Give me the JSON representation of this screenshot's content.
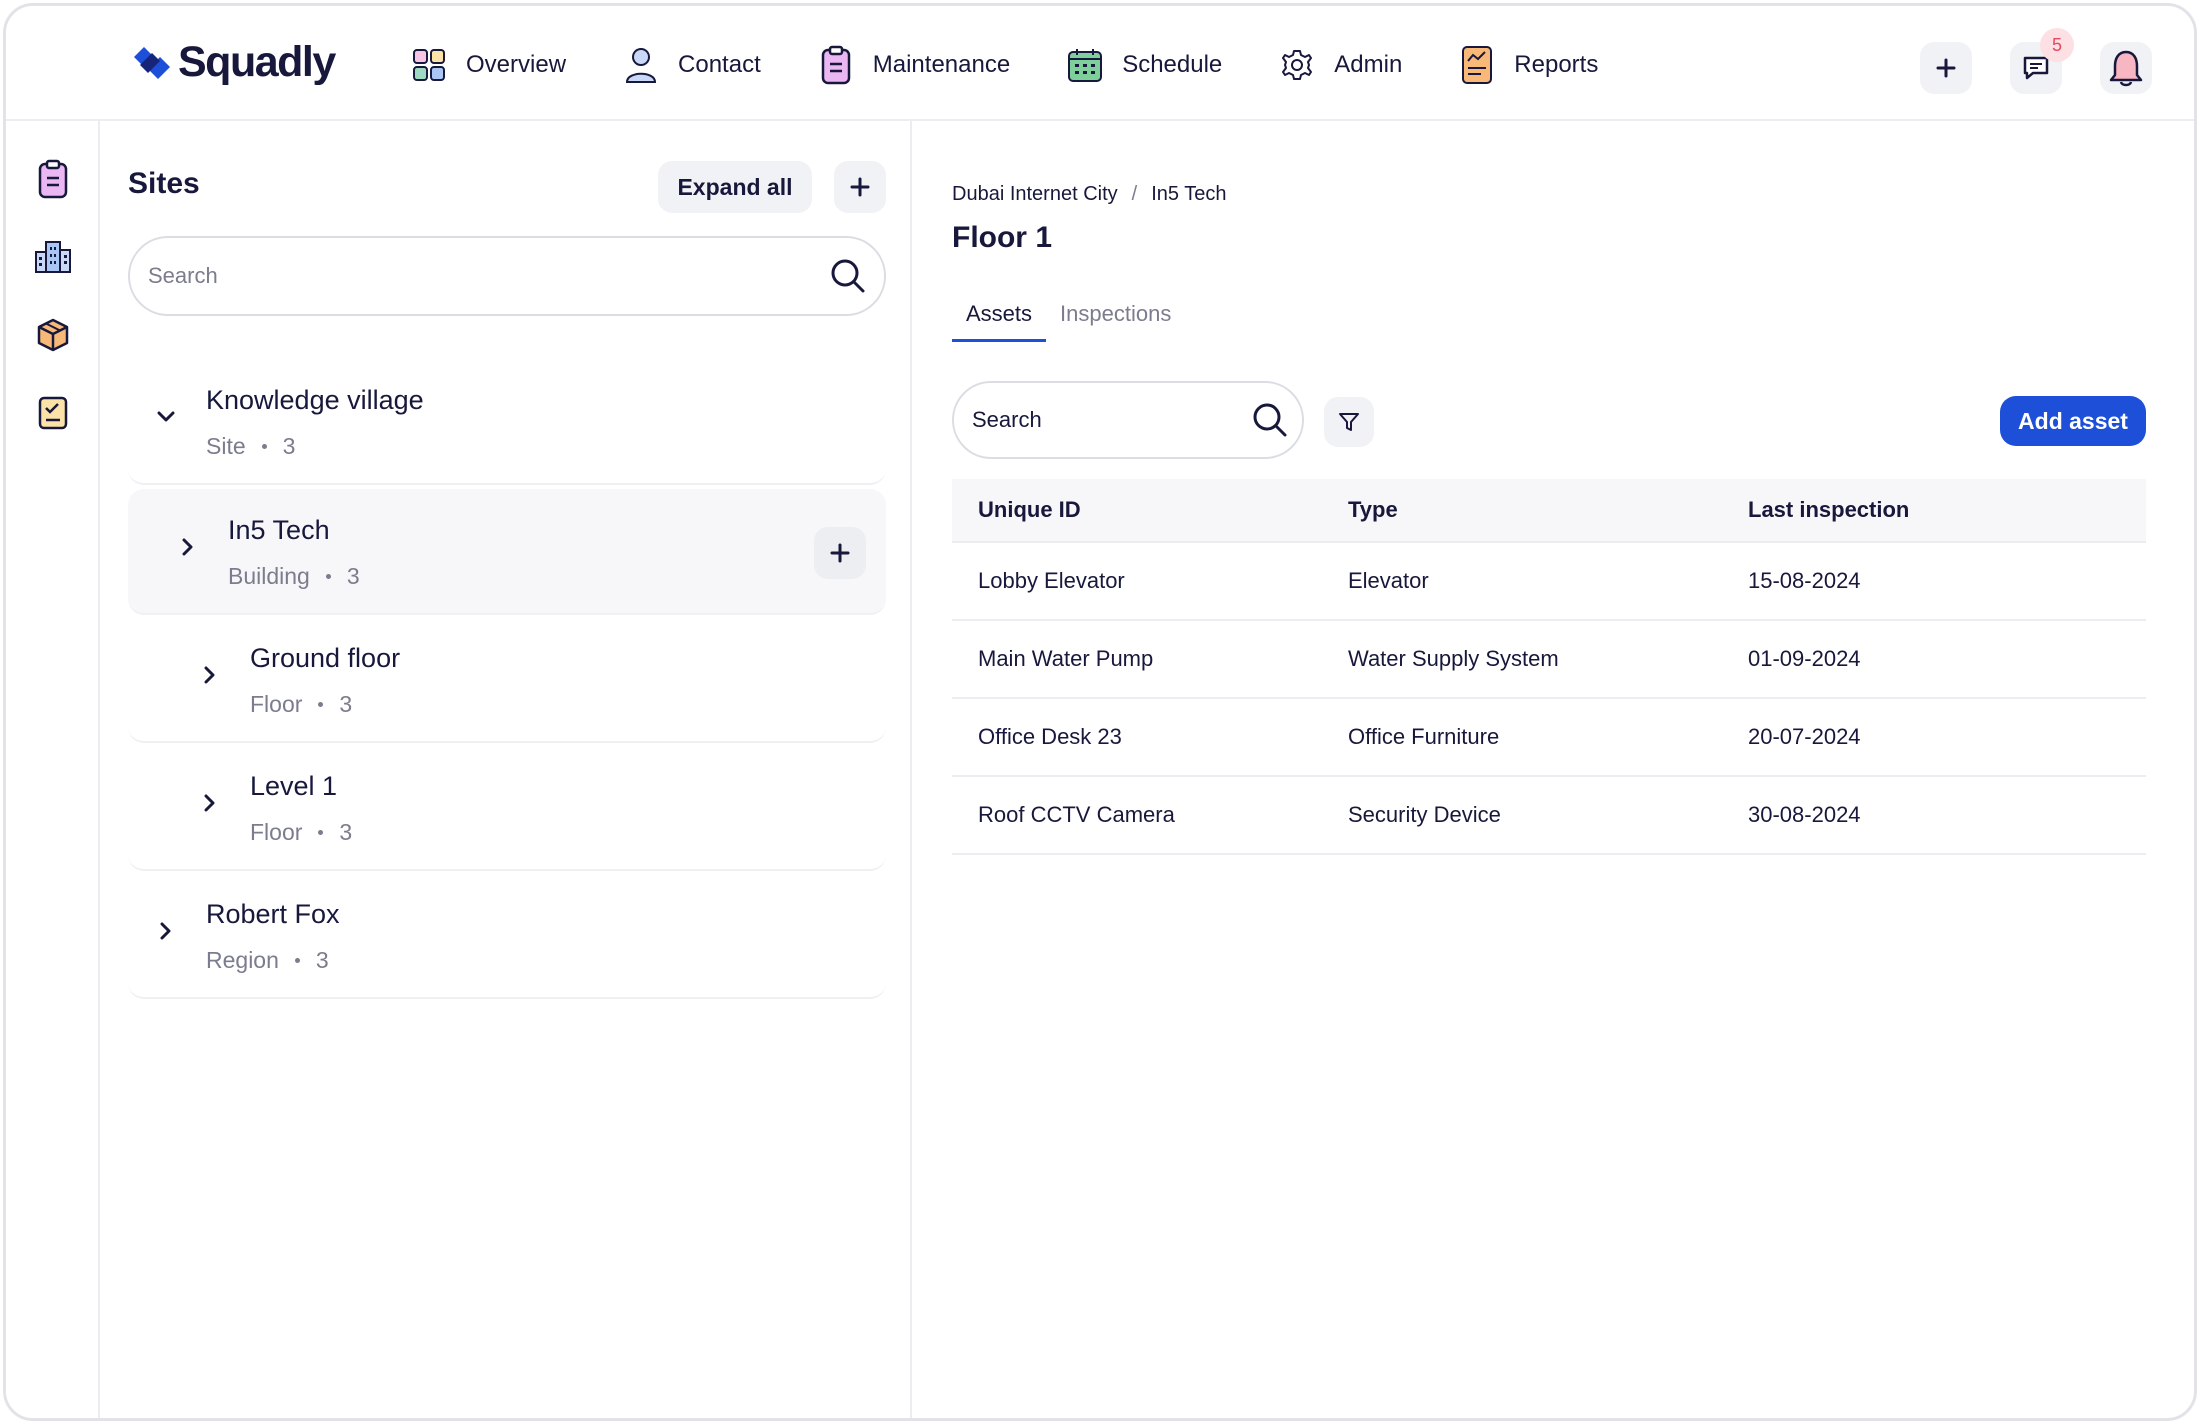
{
  "brand": {
    "name": "Squadly",
    "color": "#1d4fd8"
  },
  "nav": [
    {
      "label": "Overview",
      "icon": "overview-icon"
    },
    {
      "label": "Contact",
      "icon": "contact-icon"
    },
    {
      "label": "Maintenance",
      "icon": "maintenance-icon"
    },
    {
      "label": "Schedule",
      "icon": "schedule-icon"
    },
    {
      "label": "Admin",
      "icon": "admin-gear-icon"
    },
    {
      "label": "Reports",
      "icon": "reports-icon"
    }
  ],
  "top_actions": {
    "messages_badge": "5"
  },
  "rail": [
    "clipboard-icon",
    "building-icon",
    "box-icon",
    "checklist-icon"
  ],
  "sites": {
    "title": "Sites",
    "expand_label": "Expand all",
    "search_placeholder": "Search",
    "items": [
      {
        "name": "Knowledge village",
        "kind": "Site",
        "count": "3",
        "expanded": true
      },
      {
        "name": "In5 Tech",
        "kind": "Building",
        "count": "3",
        "selected": true
      },
      {
        "name": "Ground floor",
        "kind": "Floor",
        "count": "3"
      },
      {
        "name": "Level 1",
        "kind": "Floor",
        "count": "3"
      },
      {
        "name": "Robert Fox",
        "kind": "Region",
        "count": "3"
      }
    ]
  },
  "main": {
    "breadcrumb": [
      "Dubai Internet City",
      "In5 Tech"
    ],
    "breadcrumb_sep": "/",
    "title": "Floor 1",
    "tabs": [
      {
        "label": "Assets",
        "active": true
      },
      {
        "label": "Inspections",
        "active": false
      }
    ],
    "search_placeholder": "Search",
    "add_label": "Add asset",
    "table": {
      "headers": [
        "Unique ID",
        "Type",
        "Last inspection"
      ],
      "rows": [
        [
          "Lobby Elevator",
          "Elevator",
          "15-08-2024"
        ],
        [
          "Main Water Pump",
          "Water Supply System",
          "01-09-2024"
        ],
        [
          "Office Desk 23",
          "Office Furniture",
          "20-07-2024"
        ],
        [
          "Roof CCTV Camera",
          "Security Device",
          "30-08-2024"
        ]
      ]
    }
  }
}
